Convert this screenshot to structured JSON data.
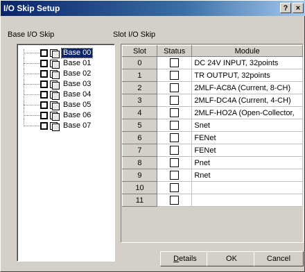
{
  "window": {
    "title": "I/O Skip Setup",
    "help_glyph": "?",
    "close_glyph": "×"
  },
  "base_panel": {
    "label": "Base I/O Skip",
    "items": [
      {
        "label": "Base 00",
        "checked": false,
        "selected": true
      },
      {
        "label": "Base 01",
        "checked": false,
        "selected": false
      },
      {
        "label": "Base 02",
        "checked": false,
        "selected": false
      },
      {
        "label": "Base 03",
        "checked": false,
        "selected": false
      },
      {
        "label": "Base 04",
        "checked": false,
        "selected": false
      },
      {
        "label": "Base 05",
        "checked": false,
        "selected": false
      },
      {
        "label": "Base 06",
        "checked": false,
        "selected": false
      },
      {
        "label": "Base 07",
        "checked": false,
        "selected": false
      }
    ]
  },
  "slot_panel": {
    "label": "Slot I/O Skip",
    "columns": [
      "Slot",
      "Status",
      "Module"
    ],
    "rows": [
      {
        "slot": "0",
        "checked": false,
        "module": "DC 24V INPUT, 32points"
      },
      {
        "slot": "1",
        "checked": false,
        "module": "TR OUTPUT, 32points"
      },
      {
        "slot": "2",
        "checked": false,
        "module": " 2MLF-AC8A (Current, 8-CH)"
      },
      {
        "slot": "3",
        "checked": false,
        "module": " 2MLF-DC4A (Current, 4-CH)"
      },
      {
        "slot": "4",
        "checked": false,
        "module": " 2MLF-HO2A (Open-Collector,"
      },
      {
        "slot": "5",
        "checked": false,
        "module": "Snet"
      },
      {
        "slot": "6",
        "checked": false,
        "module": "FENet"
      },
      {
        "slot": "7",
        "checked": false,
        "module": "FENet"
      },
      {
        "slot": "8",
        "checked": false,
        "module": "Pnet"
      },
      {
        "slot": "9",
        "checked": false,
        "module": "Rnet"
      },
      {
        "slot": "10",
        "checked": false,
        "module": ""
      },
      {
        "slot": "11",
        "checked": false,
        "module": ""
      }
    ]
  },
  "buttons": {
    "details_mnemonic": "D",
    "details_rest": "etails",
    "ok": "OK",
    "cancel": "Cancel"
  }
}
